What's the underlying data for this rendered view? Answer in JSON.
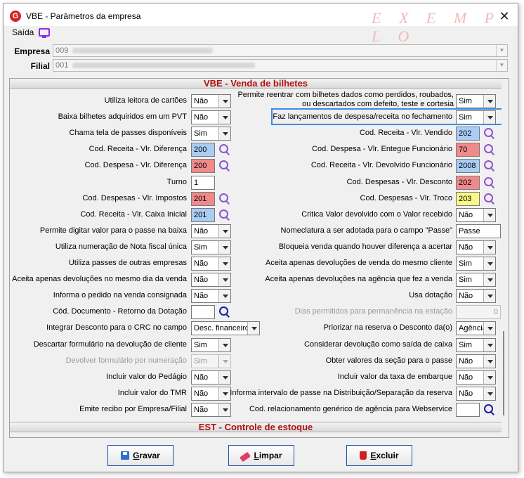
{
  "window": {
    "title": "VBE - Parâmetros da empresa",
    "watermark": "E X E M P L O",
    "close_glyph": "✕"
  },
  "menu": {
    "saida": "Saída"
  },
  "header": {
    "empresa_label": "Empresa",
    "empresa_code": "009",
    "filial_label": "Filial",
    "filial_code": "001"
  },
  "sections": {
    "vbe": "VBE - Venda de bilhetes",
    "est": "EST - Controle de estoque"
  },
  "colors": {
    "blue_code": "#a9cdf5",
    "red_code": "#f08a8a",
    "yellow_code": "#f8f888",
    "white_code": "#ffffff",
    "accent_section": "#b01010"
  },
  "left": [
    {
      "label": "Utiliza leitora de cartões",
      "kind": "select",
      "value": "Não"
    },
    {
      "label": "Baixa bilhetes adquiridos em um PVT",
      "kind": "select",
      "value": "Não"
    },
    {
      "label": "Chama tela de passes disponíveis",
      "kind": "select",
      "value": "Sim"
    },
    {
      "label": "Cod. Receita - Vlr. Diferença",
      "kind": "code",
      "value": "200",
      "color": "blue"
    },
    {
      "label": "Cod. Despesa - Vlr. Diferença",
      "kind": "code",
      "value": "200",
      "color": "red"
    },
    {
      "label": "Turno",
      "kind": "code",
      "value": "1",
      "color": "white"
    },
    {
      "label": "Cod. Despesas - Vlr. Impostos",
      "kind": "code",
      "value": "201",
      "color": "red"
    },
    {
      "label": "Cod. Receita - Vlr. Caixa Inicial",
      "kind": "code",
      "value": "201",
      "color": "blue"
    },
    {
      "label": "Permite digitar valor para o passe na baixa",
      "kind": "select",
      "value": "Não"
    },
    {
      "label": "Utiliza numeração de Nota fiscal única",
      "kind": "select",
      "value": "Sim"
    },
    {
      "label": "Utiliza passes de outras empresas",
      "kind": "select",
      "value": "Não"
    },
    {
      "label": "Aceita apenas devoluções no mesmo dia da venda",
      "kind": "select",
      "value": "Não"
    },
    {
      "label": "Informa o pedido na venda consignada",
      "kind": "select",
      "value": "Não"
    },
    {
      "label": "Cód. Documento - Retorno da Dotação",
      "kind": "code-dark",
      "value": "",
      "color": "white"
    },
    {
      "label": "Integrar Desconto para o CRC no campo",
      "kind": "select-wide",
      "value": "Desc. financeiro"
    },
    {
      "label": "Descartar formulário na devolução de cliente",
      "kind": "select",
      "value": "Sim"
    },
    {
      "label": "Devolver formulário por numeração",
      "kind": "select",
      "value": "Sim",
      "disabled": true
    },
    {
      "label": "Incluir valor do Pedágio",
      "kind": "select",
      "value": "Não"
    },
    {
      "label": "Incluir valor do TMR",
      "kind": "select",
      "value": "Não"
    },
    {
      "label": "Emite recibo por Empresa/Filial",
      "kind": "select",
      "value": "Não"
    }
  ],
  "right": [
    {
      "label": "Permite reentrar com bilhetes dados como perdidos, roubados, ou descartados com defeito, teste e cortesia",
      "kind": "select",
      "value": "Sim",
      "multiline": true
    },
    {
      "label": "Faz lançamentos de despesa/receita no fechamento",
      "kind": "select",
      "value": "Sim",
      "focus": true
    },
    {
      "label": "Cod. Receita - Vlr. Vendido",
      "kind": "code",
      "value": "202",
      "color": "blue"
    },
    {
      "label": "Cod. Despesa - Vlr. Entegue Funcionário",
      "kind": "code",
      "value": "70",
      "color": "red"
    },
    {
      "label": "Cod. Receita - Vlr. Devolvido Funcionário",
      "kind": "code",
      "value": "2008",
      "color": "blue"
    },
    {
      "label": "Cod. Despesas - Vlr. Desconto",
      "kind": "code",
      "value": "202",
      "color": "red"
    },
    {
      "label": "Cod. Despesas - Vlr. Troco",
      "kind": "code",
      "value": "203",
      "color": "yellow"
    },
    {
      "label": "Critica Valor devolvido com o Valor recebido",
      "kind": "select",
      "value": "Não"
    },
    {
      "label": "Nomeclatura a ser adotada para o campo \"Passe\"",
      "kind": "text",
      "value": "Passe"
    },
    {
      "label": "Bloqueia venda quando houver diferença a acertar",
      "kind": "select",
      "value": "Não"
    },
    {
      "label": "Aceita apenas devoluções de venda do mesmo cliente",
      "kind": "select",
      "value": "Sim"
    },
    {
      "label": "Aceita apenas devoluções na agência que fez a venda",
      "kind": "select",
      "value": "Sim"
    },
    {
      "label": "Usa dotação",
      "kind": "select",
      "value": "Não"
    },
    {
      "label": "Dias permitidos para permanência na estação",
      "kind": "number",
      "value": "0",
      "disabled": true
    },
    {
      "label": "Priorizar na reserva o Desconto da(o)",
      "kind": "select",
      "value": "Agência"
    },
    {
      "label": "Considerar devolução como saída de caixa",
      "kind": "select",
      "value": "Sim"
    },
    {
      "label": "Obter valores da seção para o passe",
      "kind": "select",
      "value": "Não"
    },
    {
      "label": "Incluir valor da taxa de embarque",
      "kind": "select",
      "value": "Não"
    },
    {
      "label": "Informa intervalo de passe na Distribuição/Separação da reserva",
      "kind": "select",
      "value": "Não"
    },
    {
      "label": "Cod. relacionamento genérico de agência para Webservice",
      "kind": "code-dark",
      "value": "",
      "color": "white"
    }
  ],
  "buttons": {
    "gravar_first": "G",
    "gravar_rest": "ravar",
    "limpar_first": "L",
    "limpar_rest": "impar",
    "excluir_first": "E",
    "excluir_rest": "xcluir"
  }
}
